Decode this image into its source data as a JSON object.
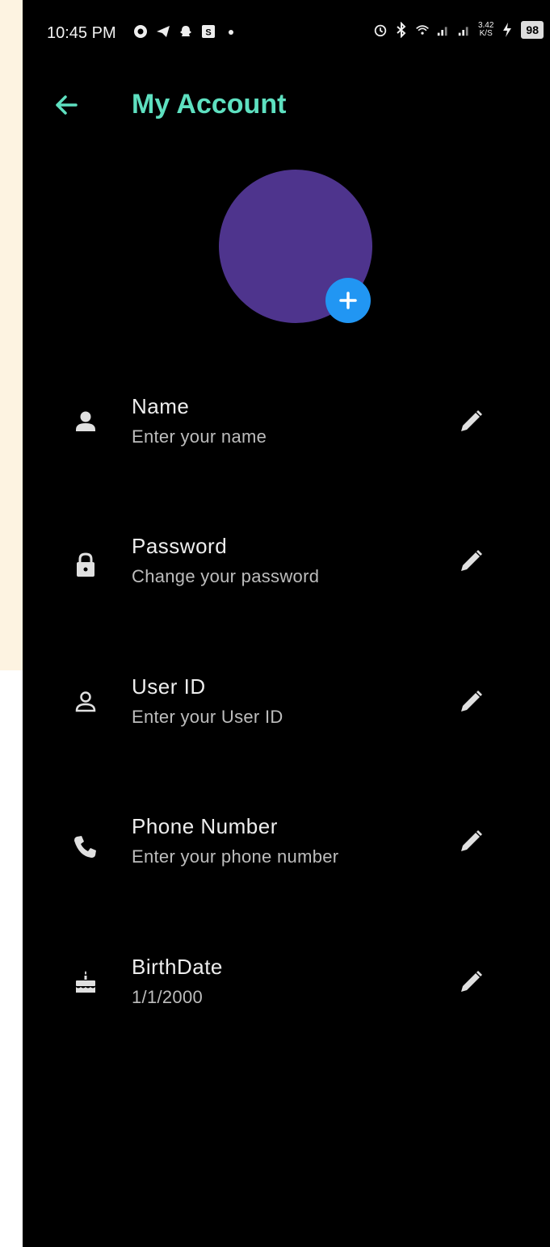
{
  "statusbar": {
    "time": "10:45 PM",
    "left_icons": [
      "chrome-icon",
      "telegram-icon",
      "snapchat-icon",
      "app-s-icon",
      "dot-icon"
    ],
    "right_icons": [
      "alarm-icon",
      "bluetooth-icon",
      "wifi-icon",
      "signal-icon",
      "signal-icon",
      "charging-icon"
    ],
    "net_speed_value": "3.42",
    "net_speed_unit": "K/S",
    "battery": "98"
  },
  "appbar": {
    "title": "My Account",
    "back_icon": "arrow-back-icon"
  },
  "avatar": {
    "color": "#4e348d",
    "add_button_color": "#2196f3",
    "add_icon": "plus-icon"
  },
  "fields": [
    {
      "label": "Name",
      "value": "Enter your name",
      "icon": "person-icon"
    },
    {
      "label": "Password",
      "value": "Change your password",
      "icon": "lock-icon"
    },
    {
      "label": "User ID",
      "value": "Enter your User ID",
      "icon": "person-outline-icon"
    },
    {
      "label": "Phone Number",
      "value": "Enter your phone number",
      "icon": "phone-icon"
    },
    {
      "label": "BirthDate",
      "value": "1/1/2000",
      "icon": "cake-icon"
    }
  ],
  "colors": {
    "accent": "#5ee0c0",
    "background": "#000000"
  }
}
